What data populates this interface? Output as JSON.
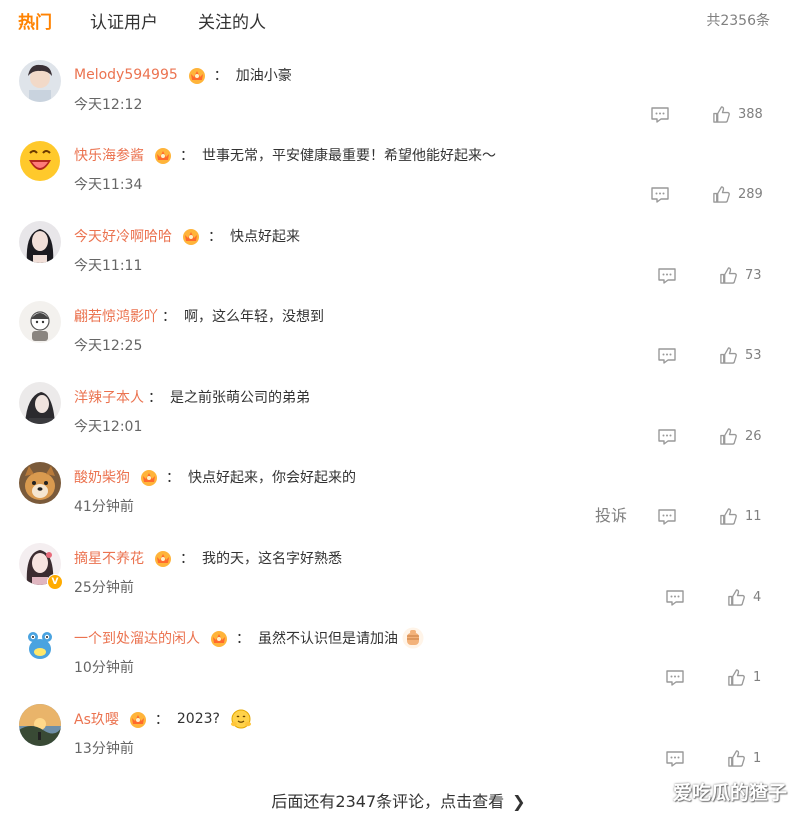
{
  "tabs": [
    {
      "label": "热门",
      "active": true
    },
    {
      "label": "认证用户",
      "active": false
    },
    {
      "label": "关注的人",
      "active": false
    }
  ],
  "total_label": "共2356条",
  "comments": [
    {
      "user": "Melody594995",
      "text": "加油小豪",
      "time": "今天12:12",
      "likes": "388"
    },
    {
      "user": "快乐海参酱",
      "text": "世事无常，平安健康最重要！希望他能好起来～",
      "time": "今天11:34",
      "likes": "289"
    },
    {
      "user": "今天好冷啊哈哈",
      "text": "快点好起来",
      "time": "今天11:11",
      "likes": "73"
    },
    {
      "user": "翩若惊鸿影吖",
      "text": "啊，这么年轻，没想到",
      "time": "今天12:25",
      "likes": "53"
    },
    {
      "user": "洋辣子本人",
      "text": "是之前张萌公司的弟弟",
      "time": "今天12:01",
      "likes": "26"
    },
    {
      "user": "酸奶柴狗",
      "text": "快点好起来，你会好起来的",
      "time": "41分钟前",
      "likes": "11",
      "report": "投诉"
    },
    {
      "user": "摘星不养花",
      "text": "我的天，这名字好熟悉",
      "time": "25分钟前",
      "likes": "4"
    },
    {
      "user": "一个到处溜达的闲人",
      "text": "虽然不认识但是请加油",
      "time": "10分钟前",
      "likes": "1"
    },
    {
      "user": "As玖嘤",
      "text": "2023?",
      "time": "13分钟前",
      "likes": "1"
    }
  ],
  "more_label": "后面还有2347条评论，点击查看",
  "watermark": "爱吃瓜的猹子",
  "colors": {
    "accent": "#ff8200",
    "username": "#eb7350",
    "icon": "#999999"
  },
  "icons": {
    "reply": "comment-bubble-icon",
    "like": "thumbs-up-icon",
    "badge": "member-crown-icon",
    "more": "chevron-right-icon"
  }
}
